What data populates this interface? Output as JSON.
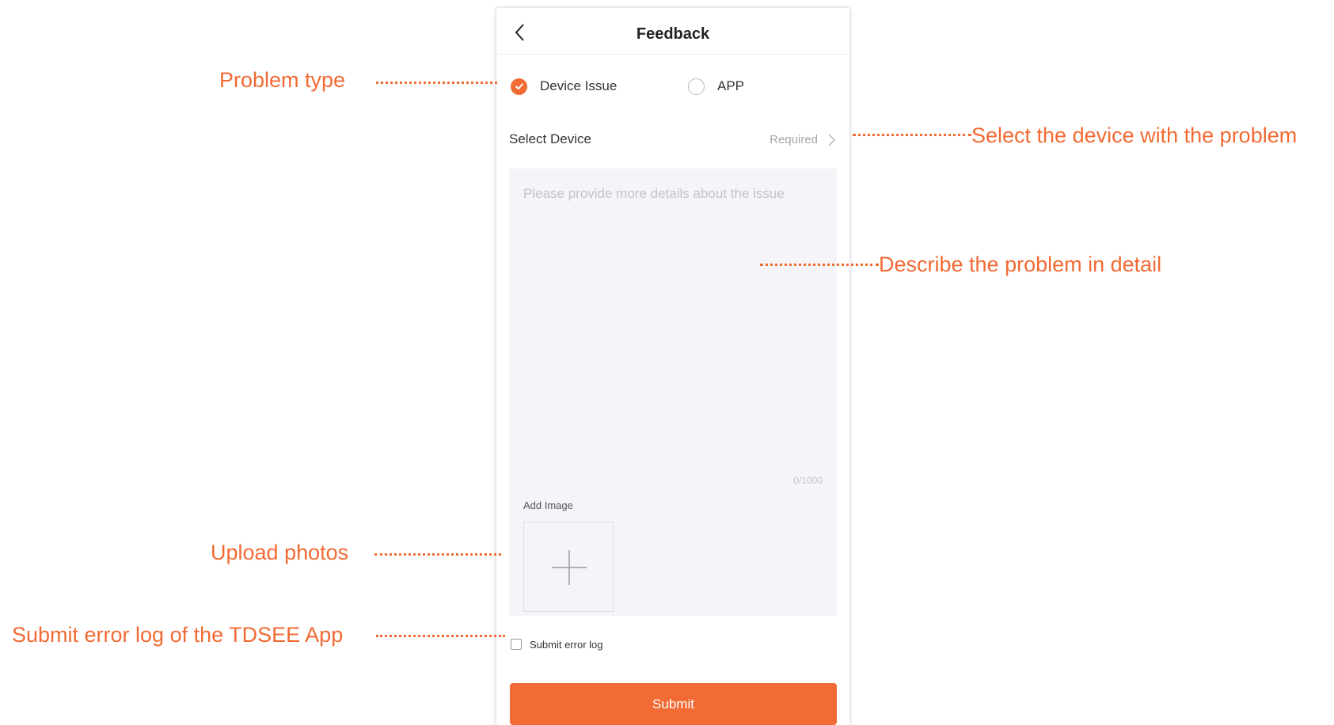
{
  "header": {
    "title": "Feedback",
    "back_icon": "chevron-left-icon"
  },
  "problem_type": {
    "options": [
      {
        "label": "Device Issue",
        "selected": true
      },
      {
        "label": "APP",
        "selected": false
      }
    ]
  },
  "select_device": {
    "label": "Select Device",
    "value": "Required",
    "icon": "chevron-right-icon"
  },
  "description": {
    "placeholder": "Please provide more details about the issue",
    "counter": "0/1000"
  },
  "add_image": {
    "label": "Add Image",
    "icon": "plus-icon"
  },
  "error_log": {
    "label": "Submit error log",
    "checked": false
  },
  "submit": {
    "label": "Submit"
  },
  "annotations": {
    "problem_type": "Problem type",
    "select_device": "Select the device with the problem",
    "describe": "Describe the problem in detail",
    "upload": "Upload photos",
    "error_log": "Submit error log of the TDSEE App"
  },
  "colors": {
    "accent": "#f26a34",
    "panel_bg": "#f4f4f9",
    "placeholder": "#c3c3c8"
  }
}
